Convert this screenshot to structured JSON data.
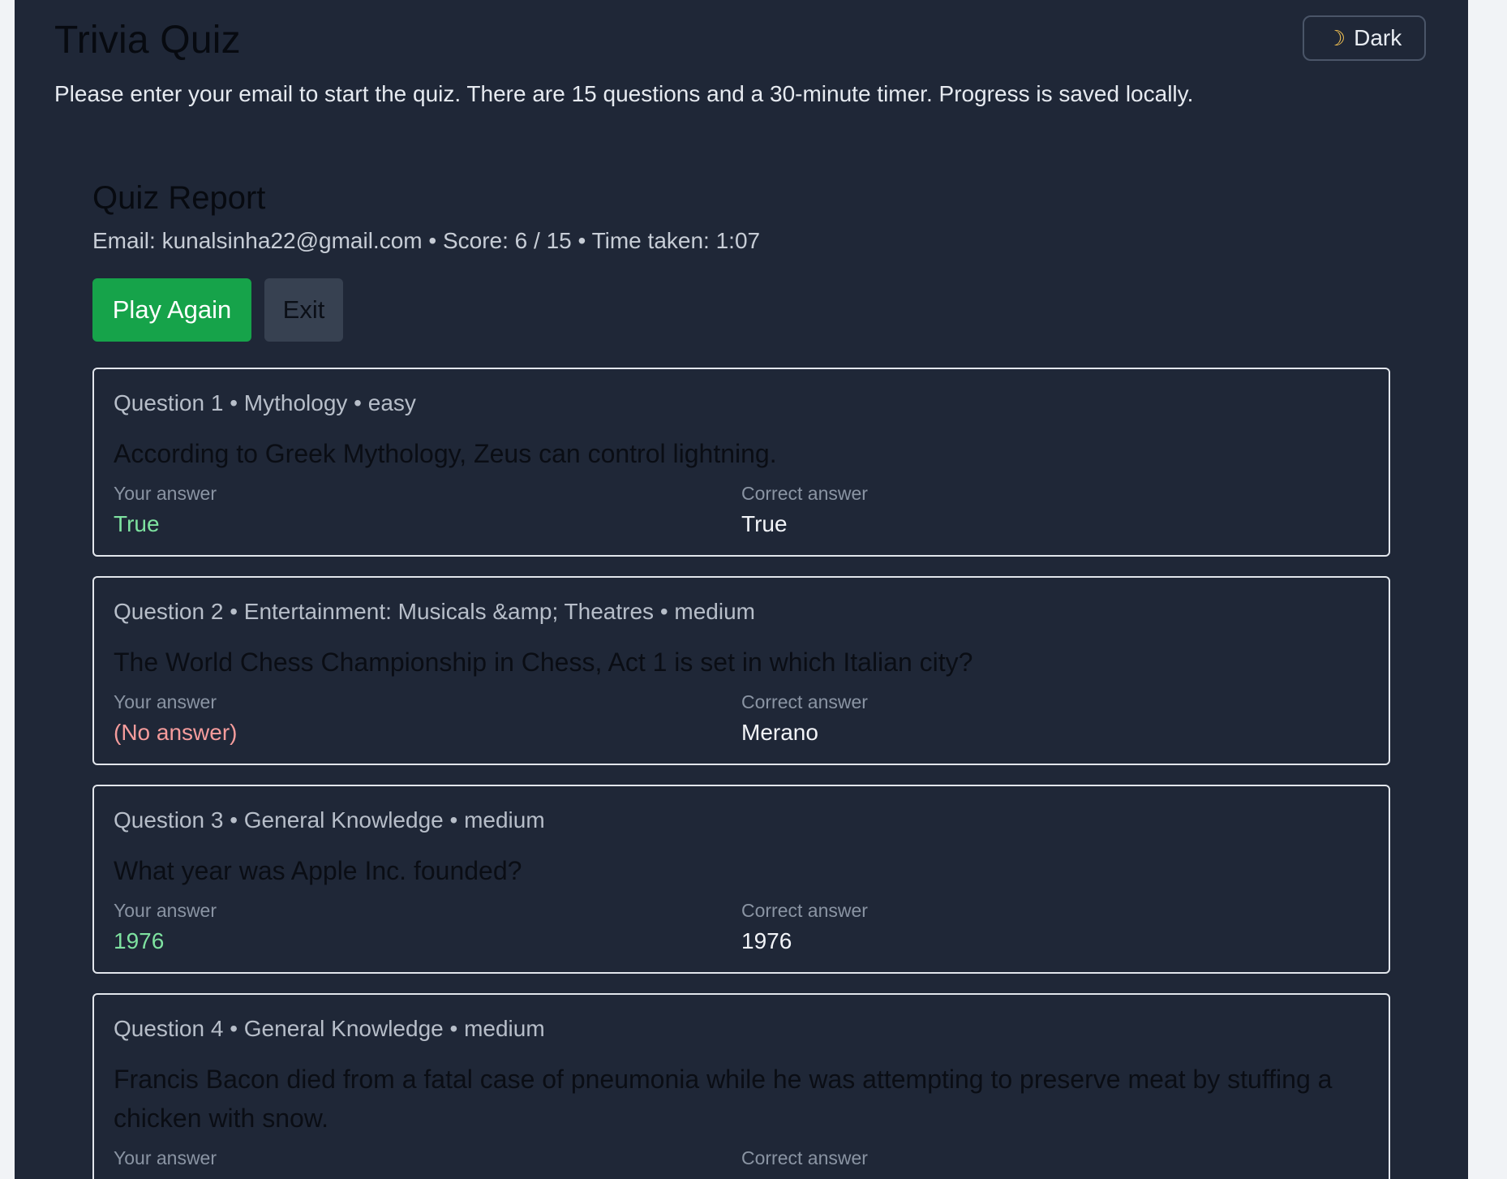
{
  "header": {
    "title": "Trivia Quiz",
    "theme_toggle": {
      "icon": "moon-icon",
      "label": "Dark"
    },
    "intro": "Please enter your email to start the quiz. There are 15 questions and a 30-minute timer. Progress is saved locally."
  },
  "report": {
    "title": "Quiz Report",
    "meta": "Email: kunalsinha22@gmail.com • Score: 6 / 15 • Time taken: 1:07",
    "play_again_label": "Play Again",
    "exit_label": "Exit",
    "your_answer_label": "Your answer",
    "correct_answer_label": "Correct answer",
    "questions": [
      {
        "meta": "Question 1 • Mythology • easy",
        "text": "According to Greek Mythology, Zeus can control lightning.",
        "your_answer": "True",
        "correct_answer": "True",
        "status": "correct"
      },
      {
        "meta": "Question 2 • Entertainment: Musicals &amp; Theatres • medium",
        "text": "The World Chess Championship in Chess, Act 1 is set in which Italian city?",
        "your_answer": "(No answer)",
        "correct_answer": "Merano",
        "status": "unanswered"
      },
      {
        "meta": "Question 3 • General Knowledge • medium",
        "text": "What year was Apple Inc. founded?",
        "your_answer": "1976",
        "correct_answer": "1976",
        "status": "correct"
      },
      {
        "meta": "Question 4 • General Knowledge • medium",
        "text": "Francis Bacon died from a fatal case of pneumonia while he was attempting to preserve meat by stuffing a chicken with snow.",
        "your_answer": "",
        "correct_answer": "",
        "status": "unknown"
      }
    ]
  },
  "colors": {
    "page_bg": "#1f2737",
    "accent_green": "#16a34a",
    "correct_text": "#7ee2a0",
    "wrong_text": "#f59c9c"
  }
}
